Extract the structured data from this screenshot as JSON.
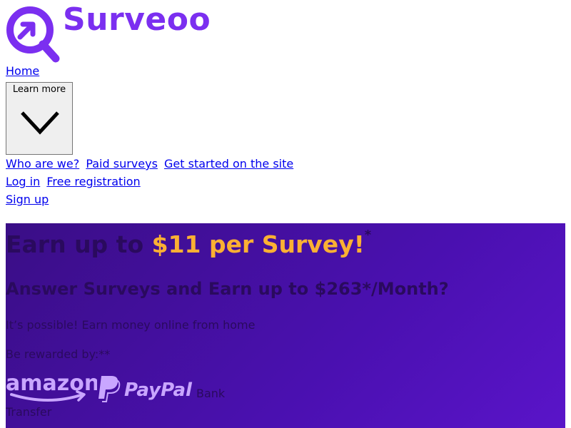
{
  "brand": {
    "name": "Surveoo",
    "logo_icon": "magnifier-arrow-icon",
    "color": "#7b2ff0"
  },
  "nav": {
    "home": "Home",
    "learn_more": "Learn more",
    "links": [
      "Who are we?",
      "Paid surveys",
      "Get started on the site"
    ],
    "auth": [
      "Log in",
      "Free registration"
    ],
    "signup": "Sign up"
  },
  "hero": {
    "title_pre": "Earn up to",
    "title_highlight": "$11 per Survey!",
    "title_asterisk": "*",
    "subtitle": "Answer Surveys and Earn up to $263*/Month?",
    "line1": "It’s possible! Earn money online from home",
    "line2": "Be rewarded by:**",
    "rewards": [
      "amazon",
      "PayPal"
    ],
    "bank_1": "Bank",
    "bank_2": "Transfer",
    "colors": {
      "highlight": "#fbb033",
      "background": "#4a10b0"
    }
  }
}
